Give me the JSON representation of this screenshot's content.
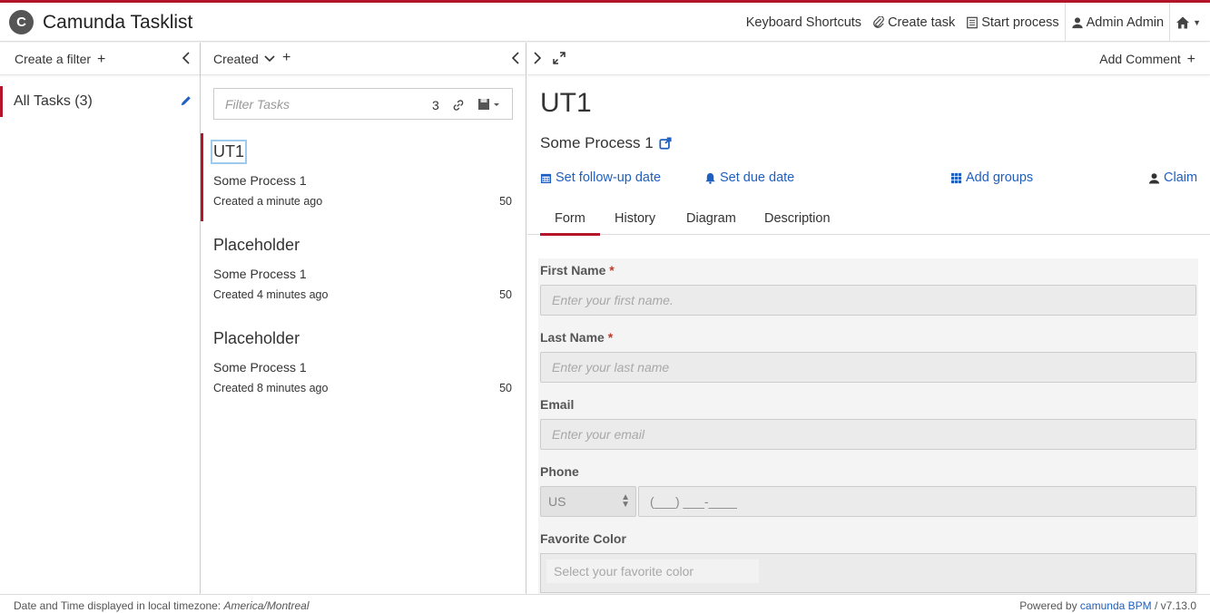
{
  "app": {
    "logo_letter": "C",
    "brand": "Camunda Tasklist"
  },
  "topnav": {
    "shortcuts": "Keyboard Shortcuts",
    "create_task": "Create task",
    "start_process": "Start process",
    "user": "Admin Admin"
  },
  "filters": {
    "header": "Create a filter",
    "items": [
      {
        "label": "All Tasks (3)"
      }
    ]
  },
  "tasklist": {
    "sort_label": "Created",
    "filter_placeholder": "Filter Tasks",
    "count": "3",
    "tasks": [
      {
        "name": "UT1",
        "process": "Some Process 1",
        "created": "Created a minute ago",
        "priority": "50"
      },
      {
        "name": "Placeholder",
        "process": "Some Process 1",
        "created": "Created 4 minutes ago",
        "priority": "50"
      },
      {
        "name": "Placeholder",
        "process": "Some Process 1",
        "created": "Created 8 minutes ago",
        "priority": "50"
      }
    ]
  },
  "detail": {
    "add_comment": "Add Comment",
    "title": "UT1",
    "process": "Some Process 1",
    "actions": {
      "follow_up": "Set follow-up date",
      "due": "Set due date",
      "groups": "Add groups",
      "claim": "Claim"
    },
    "tabs": [
      "Form",
      "History",
      "Diagram",
      "Description"
    ],
    "form": {
      "first_name": {
        "label": "First Name",
        "placeholder": "Enter your first name."
      },
      "last_name": {
        "label": "Last Name",
        "placeholder": "Enter your last name"
      },
      "email": {
        "label": "Email",
        "placeholder": "Enter your email"
      },
      "phone": {
        "label": "Phone",
        "country": "US",
        "placeholder": "(___) ___-____"
      },
      "color": {
        "label": "Favorite Color",
        "placeholder": "Select your favorite color"
      }
    }
  },
  "footer": {
    "tz_text": "Date and Time displayed in local timezone: ",
    "tz": "America/Montreal",
    "powered": "Powered by ",
    "brand": "camunda BPM",
    "version": " / v7.13.0"
  },
  "colors": {
    "accent": "#b5152b",
    "link": "#1f5fbf"
  }
}
